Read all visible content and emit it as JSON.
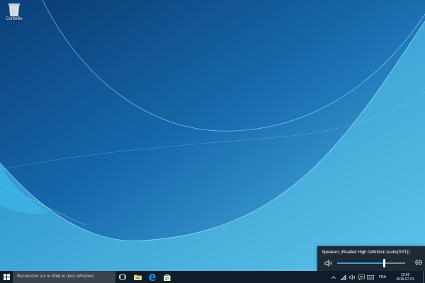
{
  "desktop": {
    "icons": [
      {
        "label": "Corbeille",
        "icon": "recycle-bin-icon"
      }
    ]
  },
  "volume_flyout": {
    "device_name": "Speakers (Realtek High Definition Audio(SST))",
    "level": "69",
    "level_value": 0.69,
    "icon": "speaker-icon"
  },
  "taskbar": {
    "search_placeholder": "Rechercher sur le Web et dans Windows",
    "apps": [
      {
        "icon": "task-view-icon"
      },
      {
        "icon": "file-explorer-icon"
      },
      {
        "icon": "edge-icon"
      },
      {
        "icon": "store-icon"
      }
    ],
    "tray": {
      "language": "FRA",
      "time": "12:45",
      "date": "2016-07-01"
    }
  },
  "colors": {
    "wallpaper_dark": "#0d4f8c",
    "wallpaper_light": "#5cc3e8",
    "taskbar": "#0f1d2a",
    "flyout": "#1e2a35",
    "accent": "#3a9ee8"
  }
}
